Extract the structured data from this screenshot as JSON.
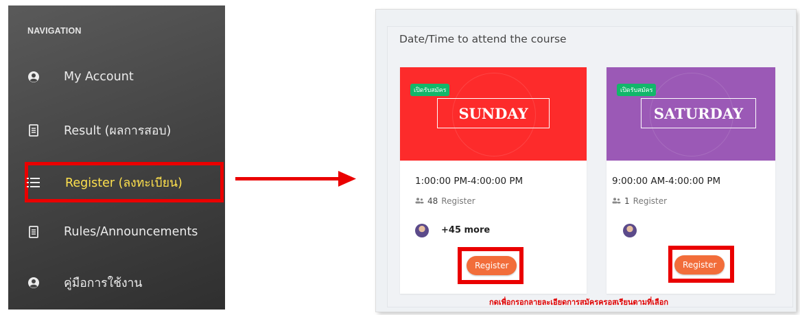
{
  "navigation": {
    "heading": "NAVIGATION",
    "items": [
      {
        "label": "My Account",
        "icon": "user-circle-icon"
      },
      {
        "label": "Result (ผลการสอบ)",
        "icon": "document-icon"
      },
      {
        "label": "Register (ลงทะเบียน)",
        "icon": "list-icon",
        "active": true
      },
      {
        "label": "Rules/Announcements",
        "icon": "document-icon"
      },
      {
        "label": "คู่มือการใช้งาน",
        "icon": "user-circle-icon"
      }
    ]
  },
  "course": {
    "title": "Date/Time to attend the course",
    "cards": [
      {
        "badge": "เปิดรับสมัคร",
        "day": "SUNDAY",
        "color": "#fd2b2b",
        "time": "1:00:00 PM-4:00:00 PM",
        "count_number": "48",
        "count_label": "Register",
        "more": "+45 more",
        "button": "Register"
      },
      {
        "badge": "เปิดรับสมัคร",
        "day": "SATURDAY",
        "color": "#9b59b6",
        "time": "9:00:00 AM-4:00:00 PM",
        "count_number": "1",
        "count_label": "Register",
        "more": "",
        "button": "Register"
      }
    ],
    "note": "กดเพื่อกรอกลายละเอียดการสมัครครอสเรียนตามที่เลือก"
  },
  "colors": {
    "highlight": "#ea0000",
    "button": "#f26d3a",
    "badge": "#12b76a",
    "active_nav": "#ffe14d"
  }
}
